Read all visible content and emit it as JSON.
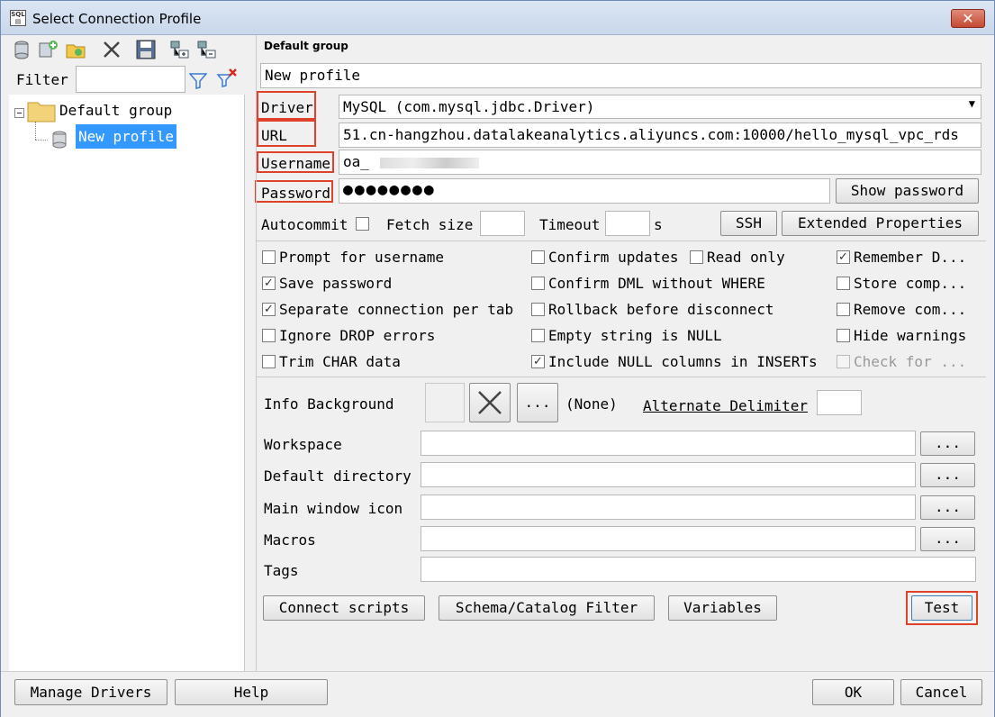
{
  "window": {
    "title": "Select Connection Profile",
    "close_glyph": "✕"
  },
  "left_pane": {
    "filter_label": "Filter",
    "tree": {
      "group": "Default group",
      "profile": "New profile"
    }
  },
  "right_pane": {
    "group_title": "Default group",
    "profile_name": "New profile",
    "driver": {
      "label": "Driver",
      "value": "MySQL (com.mysql.jdbc.Driver)"
    },
    "url": {
      "label": "URL",
      "value": "51.cn-hangzhou.datalakeanalytics.aliyuncs.com:10000/hello_mysql_vpc_rds"
    },
    "username": {
      "label": "Username",
      "value": "oa_"
    },
    "password": {
      "label": "Password",
      "value": "●●●●●●●●",
      "show_button": "Show password"
    },
    "autocommit_label": "Autocommit",
    "fetch_size_label": "Fetch size",
    "timeout_label": "Timeout",
    "timeout_unit": "s",
    "ssh_button": "SSH",
    "extended_button": "Extended Properties",
    "options": [
      {
        "label": "Prompt for username",
        "checked": false
      },
      {
        "label": "Save password",
        "checked": true
      },
      {
        "label": "Separate connection per tab",
        "checked": true
      },
      {
        "label": "Ignore DROP errors",
        "checked": false
      },
      {
        "label": "Trim CHAR data",
        "checked": false
      },
      {
        "label": "Confirm updates",
        "checked": false
      },
      {
        "label": "Read only",
        "checked": false
      },
      {
        "label": "Confirm DML without WHERE",
        "checked": false
      },
      {
        "label": "Rollback before disconnect",
        "checked": false
      },
      {
        "label": "Empty string is NULL",
        "checked": false
      },
      {
        "label": "Include NULL columns in INSERTs",
        "checked": true
      },
      {
        "label": "Remember D...",
        "checked": true
      },
      {
        "label": "Store comp...",
        "checked": false
      },
      {
        "label": "Remove com...",
        "checked": false
      },
      {
        "label": "Hide warnings",
        "checked": false
      },
      {
        "label": "Check for ...",
        "checked": false
      }
    ],
    "info_background_label": "Info Background",
    "info_none": "(None)",
    "dots": "...",
    "alternate_delimiter": "Alternate Delimiter",
    "workspace_label": "Workspace",
    "default_directory_label": "Default directory",
    "main_window_icon_label": "Main window icon",
    "macros_label": "Macros",
    "tags_label": "Tags",
    "connect_scripts": "Connect scripts",
    "schema_filter": "Schema/Catalog Filter",
    "variables": "Variables",
    "test": "Test"
  },
  "bottom": {
    "manage_drivers": "Manage Drivers",
    "help": "Help",
    "ok": "OK",
    "cancel": "Cancel"
  },
  "colors": {
    "highlight": "#e0412a",
    "selection": "#3399ff"
  }
}
